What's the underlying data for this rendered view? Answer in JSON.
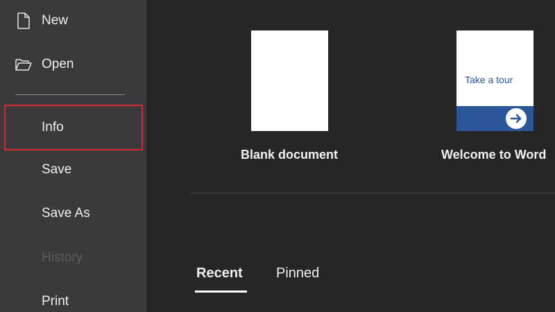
{
  "sidebar": {
    "items": [
      {
        "label": "New",
        "icon": "new-document-icon"
      },
      {
        "label": "Open",
        "icon": "open-folder-icon"
      },
      {
        "label": "Info",
        "highlighted": true,
        "highlight_color": "#d9232d"
      },
      {
        "label": "Save"
      },
      {
        "label": "Save As"
      },
      {
        "label": "History",
        "disabled": true
      },
      {
        "label": "Print"
      }
    ]
  },
  "templates": [
    {
      "label": "Blank document"
    },
    {
      "label": "Welcome to Word",
      "thumbnail_text": "Take a tour",
      "thumbnail_icon": "arrow-right-icon"
    }
  ],
  "tabs": [
    {
      "label": "Recent",
      "active": true
    },
    {
      "label": "Pinned",
      "active": false
    }
  ],
  "colors": {
    "sidebar_bg": "#3a3a3a",
    "main_bg": "#262626",
    "accent_blue": "#2b579a",
    "highlight_red": "#d9232d",
    "disabled_text": "#5c5c5c"
  }
}
